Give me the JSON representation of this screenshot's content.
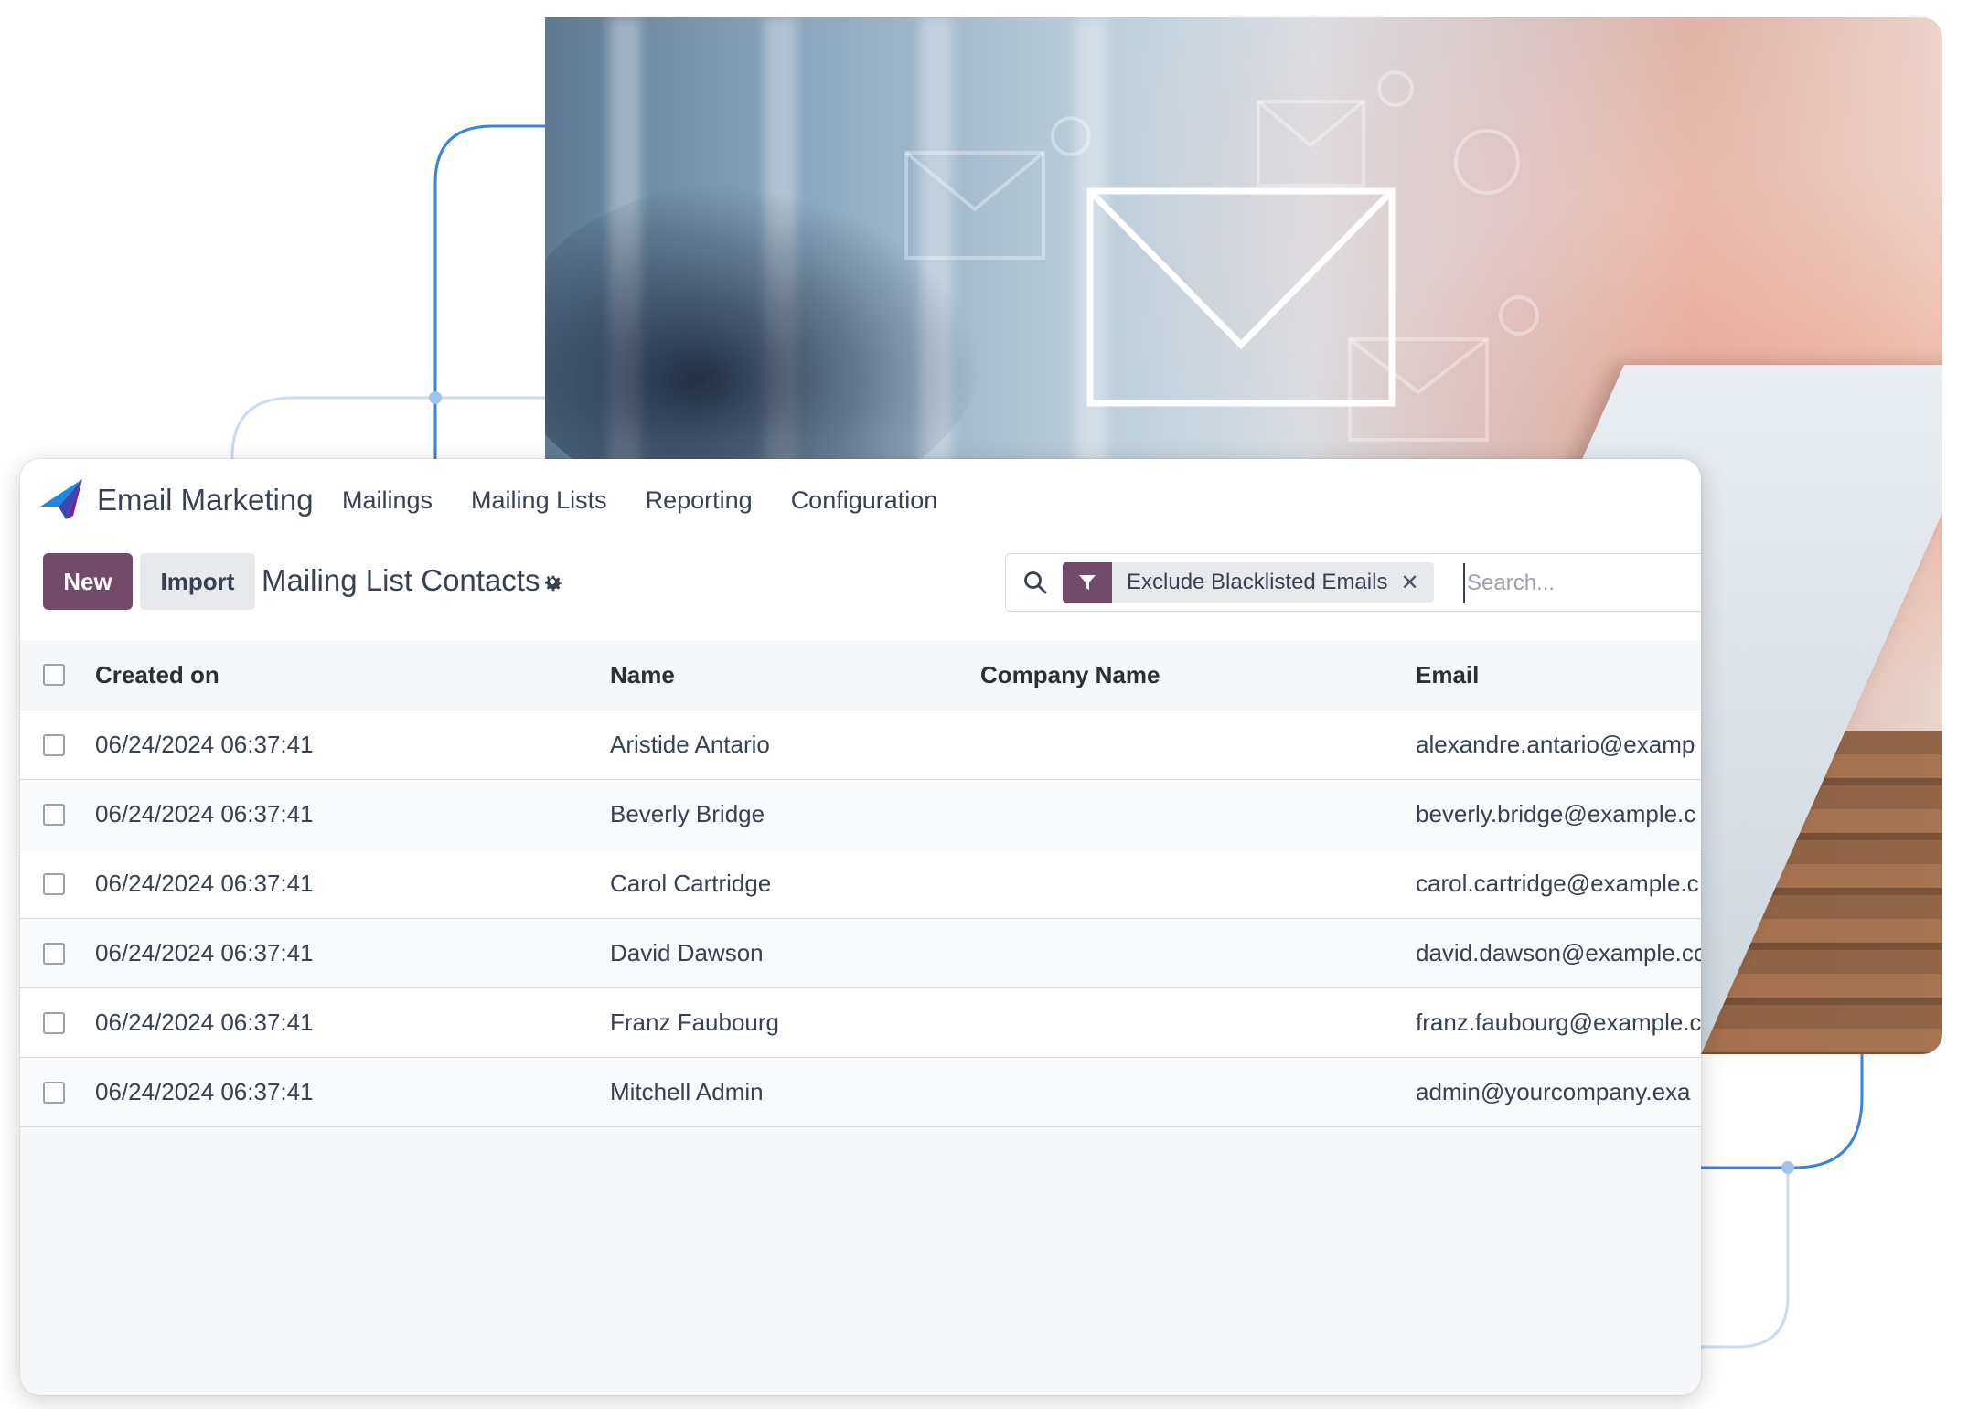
{
  "app": {
    "name": "Email Marketing",
    "menu": [
      "Mailings",
      "Mailing Lists",
      "Reporting",
      "Configuration"
    ]
  },
  "control": {
    "new_label": "New",
    "import_label": "Import",
    "title": "Mailing List Contacts"
  },
  "search": {
    "facet_label": "Exclude Blacklisted Emails",
    "facet_close": "✕",
    "placeholder": "Search..."
  },
  "table": {
    "headers": [
      "Created on",
      "Name",
      "Company Name",
      "Email"
    ],
    "rows": [
      {
        "created": "06/24/2024 06:37:41",
        "name": "Aristide Antario",
        "company": "",
        "email": "alexandre.antario@examp"
      },
      {
        "created": "06/24/2024 06:37:41",
        "name": "Beverly Bridge",
        "company": "",
        "email": "beverly.bridge@example.c"
      },
      {
        "created": "06/24/2024 06:37:41",
        "name": "Carol Cartridge",
        "company": "",
        "email": "carol.cartridge@example.c"
      },
      {
        "created": "06/24/2024 06:37:41",
        "name": "David Dawson",
        "company": "",
        "email": "david.dawson@example.co"
      },
      {
        "created": "06/24/2024 06:37:41",
        "name": "Franz Faubourg",
        "company": "",
        "email": "franz.faubourg@example.c"
      },
      {
        "created": "06/24/2024 06:37:41",
        "name": "Mitchell Admin",
        "company": "",
        "email": "admin@yourcompany.exa"
      }
    ]
  },
  "colors": {
    "brand": "#714b67",
    "deco_line": "#3b82e0",
    "deco_line_light": "#c9dcf5"
  },
  "icons": [
    "paper-plane-icon",
    "gear-icon",
    "search-icon",
    "filter-icon",
    "close-icon",
    "envelope-icon"
  ]
}
